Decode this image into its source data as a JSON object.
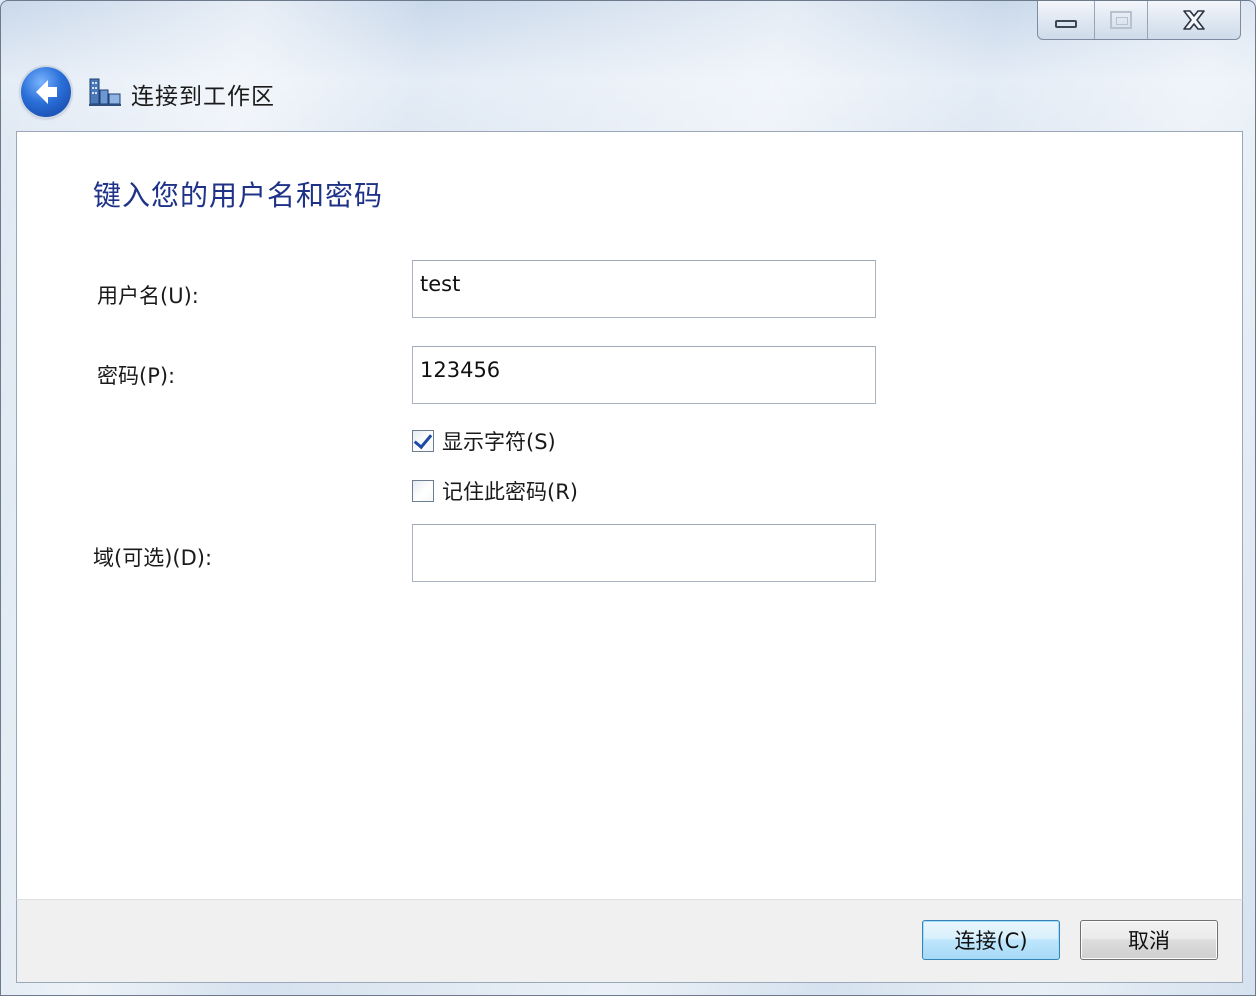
{
  "window": {
    "title": "连接到工作区"
  },
  "icons": {
    "back": "back-arrow-icon",
    "app": "workplace-connection-icon",
    "minimize": "minimize-icon",
    "maximize": "maximize-icon",
    "close": "close-icon"
  },
  "page": {
    "heading": "键入您的用户名和密码"
  },
  "form": {
    "username": {
      "label": "用户名(U):",
      "value": "test"
    },
    "password": {
      "label": "密码(P):",
      "value": "123456"
    },
    "show_chars": {
      "label": "显示字符(S)",
      "checked": true
    },
    "remember": {
      "label": "记住此密码(R)",
      "checked": false
    },
    "domain": {
      "label": "域(可选)(D):",
      "value": ""
    }
  },
  "footer": {
    "connect_label": "连接(C)",
    "cancel_label": "取消"
  },
  "colors": {
    "heading": "#1e3287",
    "primary_button_border": "#3c7fb1"
  }
}
